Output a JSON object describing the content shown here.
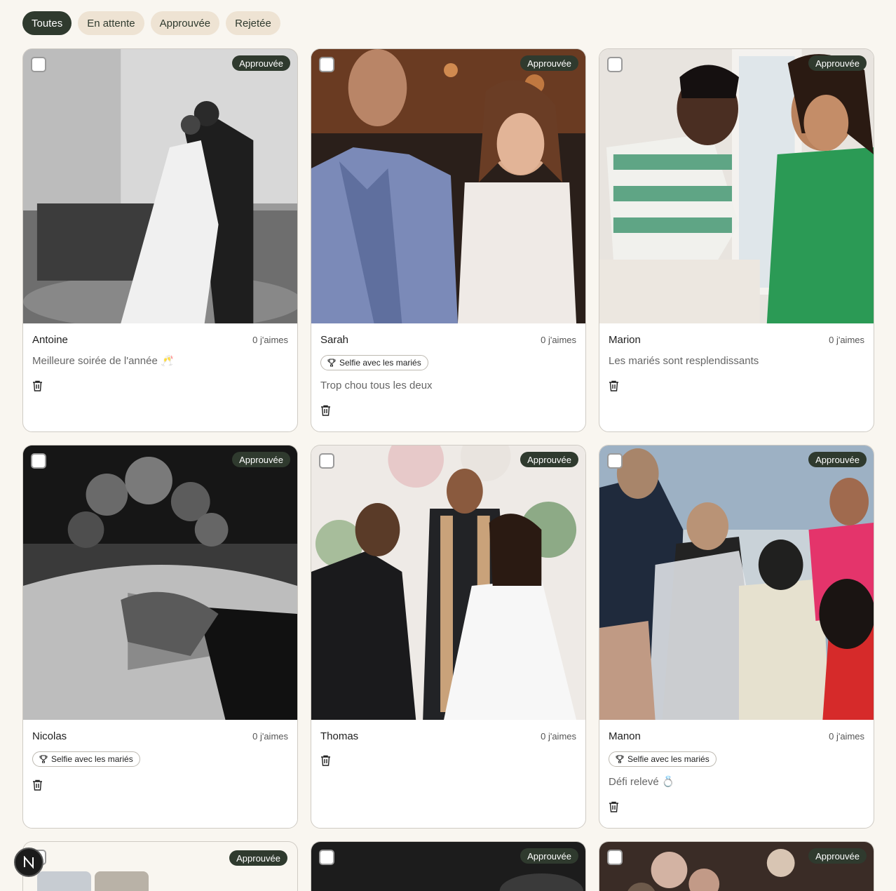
{
  "filters": [
    {
      "label": "Toutes",
      "active": true
    },
    {
      "label": "En attente",
      "active": false
    },
    {
      "label": "Approuvée",
      "active": false
    },
    {
      "label": "Rejetée",
      "active": false
    }
  ],
  "cards": [
    {
      "author": "Antoine",
      "likes": "0 j'aimes",
      "status": "Approuvée",
      "tag": "",
      "comment": "Meilleure soirée de l'année 🥂"
    },
    {
      "author": "Sarah",
      "likes": "0 j'aimes",
      "status": "Approuvée",
      "tag": "Selfie avec les mariés",
      "comment": "Trop chou tous les deux"
    },
    {
      "author": "Marion",
      "likes": "0 j'aimes",
      "status": "Approuvée",
      "tag": "",
      "comment": "Les mariés sont resplendissants"
    },
    {
      "author": "Nicolas",
      "likes": "0 j'aimes",
      "status": "Approuvée",
      "tag": "Selfie avec les mariés",
      "comment": ""
    },
    {
      "author": "Thomas",
      "likes": "0 j'aimes",
      "status": "Approuvée",
      "tag": "",
      "comment": ""
    },
    {
      "author": "Manon",
      "likes": "0 j'aimes",
      "status": "Approuvée",
      "tag": "Selfie avec les mariés",
      "comment": "Défi relevé 💍"
    },
    {
      "status": "Approuvée"
    },
    {
      "status": "Approuvée"
    },
    {
      "status": "Approuvée"
    }
  ],
  "fab": {
    "letter": "N"
  },
  "icons": {
    "trash": "trash-icon",
    "trophy": "trophy-icon",
    "checkbox": "checkbox-icon"
  },
  "colors": {
    "accent": "#2f3a2e",
    "chip_bg": "#eee3d3",
    "page_bg": "#f9f6f0"
  }
}
